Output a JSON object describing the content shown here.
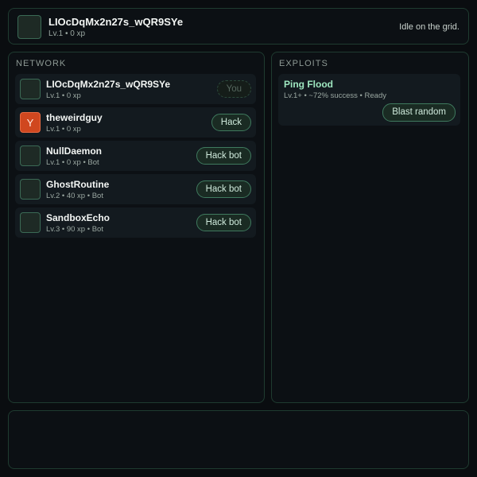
{
  "header": {
    "name": "LIOcDqMx2n27s_wQR9SYe",
    "meta": "Lv.1 • 0 xp",
    "status": "Idle on the grid."
  },
  "network": {
    "title": "NETWORK",
    "rows": [
      {
        "name": "LIOcDqMx2n27s_wQR9SYe",
        "meta": "Lv.1 • 0 xp",
        "action": "You",
        "avatar": ""
      },
      {
        "name": "theweirdguy",
        "meta": "Lv.1 • 0 xp",
        "action": "Hack",
        "avatar": "Y"
      },
      {
        "name": "NullDaemon",
        "meta": "Lv.1 • 0 xp • Bot",
        "action": "Hack bot",
        "avatar": ""
      },
      {
        "name": "GhostRoutine",
        "meta": "Lv.2 • 40 xp • Bot",
        "action": "Hack bot",
        "avatar": ""
      },
      {
        "name": "SandboxEcho",
        "meta": "Lv.3 • 90 xp • Bot",
        "action": "Hack bot",
        "avatar": ""
      }
    ]
  },
  "exploits": {
    "title": "EXPLOITS",
    "items": [
      {
        "name": "Ping Flood",
        "meta": "Lv.1+ • ~72% success • Ready",
        "action": "Blast random"
      }
    ]
  },
  "colors": {
    "accent": "#9ee7c0",
    "border": "#1f3b30",
    "avatar_orange": "#d0471f",
    "background": "#0a0d10"
  }
}
